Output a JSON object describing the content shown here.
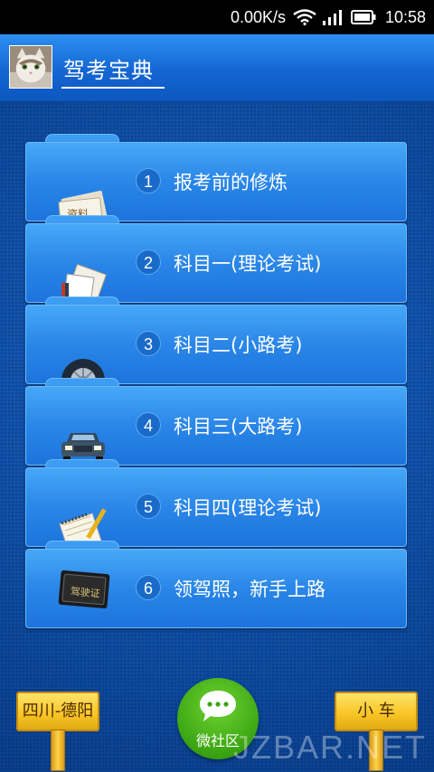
{
  "status_bar": {
    "network_speed": "0.00K/s",
    "time": "10:58",
    "icons": [
      "wifi-icon",
      "signal-icon",
      "battery-icon"
    ]
  },
  "header": {
    "title": "驾考宝典",
    "avatar_icon": "cat-avatar-icon"
  },
  "menu": [
    {
      "number": "1",
      "label": "报考前的修炼",
      "icon": "documents-icon"
    },
    {
      "number": "2",
      "label": "科目一(理论考试)",
      "icon": "books-icon"
    },
    {
      "number": "3",
      "label": "科目二(小路考)",
      "icon": "tire-icon"
    },
    {
      "number": "4",
      "label": "科目三(大路考)",
      "icon": "car-icon"
    },
    {
      "number": "5",
      "label": "科目四(理论考试)",
      "icon": "notebook-icon"
    },
    {
      "number": "6",
      "label": "领驾照，新手上路",
      "icon": "license-icon"
    }
  ],
  "footer": {
    "location_label": "四川-德阳",
    "community_label": "微社区",
    "vehicle_label": "小 车",
    "watermark": "JZBAR.NET"
  },
  "colors": {
    "primary_blue": "#1466d3",
    "background_blue": "#0f51ab",
    "sign_yellow": "#f7c423",
    "wechat_green": "#3aa413"
  }
}
